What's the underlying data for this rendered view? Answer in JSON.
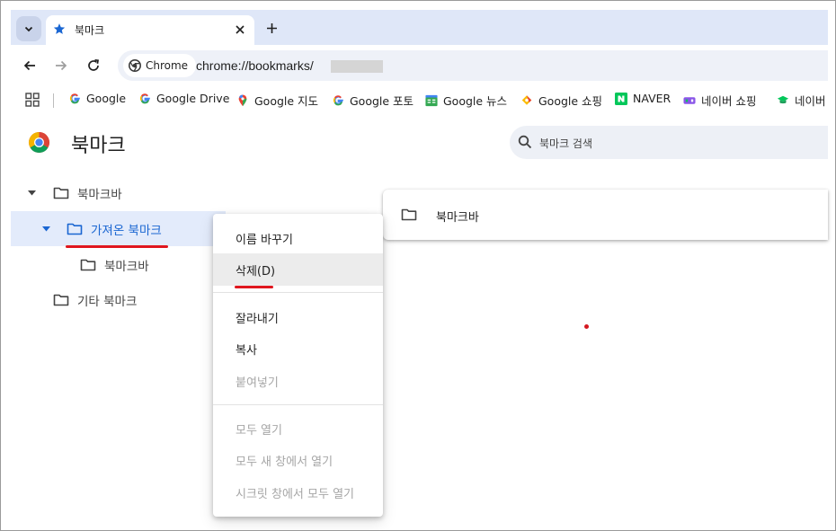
{
  "tab": {
    "title": "북마크"
  },
  "toolbar": {
    "chip_label": "Chrome",
    "url": "chrome://bookmarks/"
  },
  "bookmarks_bar": [
    {
      "label": "Google",
      "icon": "google-icon"
    },
    {
      "label": "Google Drive",
      "icon": "google-icon"
    },
    {
      "label": "Google 지도",
      "icon": "maps-pin-icon"
    },
    {
      "label": "Google 포토",
      "icon": "google-icon"
    },
    {
      "label": "Google 뉴스",
      "icon": "google-news-icon"
    },
    {
      "label": "Google 쇼핑",
      "icon": "google-shopping-icon"
    },
    {
      "label": "NAVER",
      "icon": "naver-icon"
    },
    {
      "label": "네이버 쇼핑",
      "icon": "naver-shopping-icon"
    },
    {
      "label": "네이버",
      "icon": "naver-cap-icon"
    }
  ],
  "page": {
    "title": "북마크",
    "search_placeholder": "북마크 검색"
  },
  "tree": {
    "bookmark_bar": "북마크바",
    "imported": "가져온 북마크",
    "imported_child": "북마크바",
    "other": "기타 북마크"
  },
  "content": {
    "items": [
      {
        "label": "북마크바"
      }
    ]
  },
  "context_menu": {
    "rename": "이름 바꾸기",
    "delete": "삭제(D)",
    "cut": "잘라내기",
    "copy": "복사",
    "paste": "붙여넣기",
    "open_all": "모두 열기",
    "open_all_new_window": "모두 새 창에서 열기",
    "open_all_incognito": "시크릿 창에서 모두 열기"
  },
  "colors": {
    "accent": "#1a66d2",
    "annotation": "#e0161e",
    "tabstrip": "#dfe7f8"
  }
}
